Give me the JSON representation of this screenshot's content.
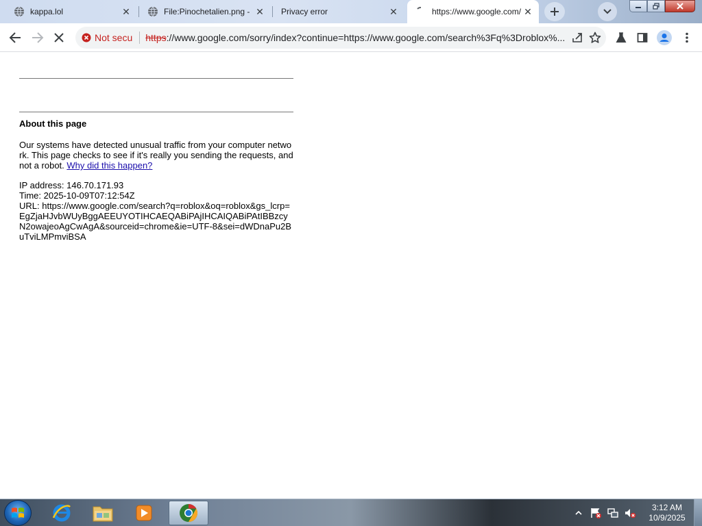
{
  "tabs": [
    {
      "title": "kappa.lol",
      "favicon": "globe-icon"
    },
    {
      "title": "File:Pinochetalien.png -",
      "favicon": "globe-icon"
    },
    {
      "title": "Privacy error",
      "favicon": "none"
    },
    {
      "title": "https://www.google.com/sorry",
      "favicon": "loading-spinner-icon",
      "active": true
    }
  ],
  "omnibox": {
    "security_label": "Not secu",
    "url_scheme": "https",
    "url_host": "://www.google.com",
    "url_path": "/sorry/index?continue=https://www.google.com/search%3Fq%3Droblox%..."
  },
  "page": {
    "about_title": "About this page",
    "para_text": "Our systems have detected unusual traffic from your computer network. This page checks to see if it's really you sending the requests, and not a robot. ",
    "why_link": "Why did this happen?",
    "ip_line": "IP address: 146.70.171.93",
    "time_line": "Time: 2025-10-09T07:12:54Z",
    "url_line": "URL: https://www.google.com/search?q=roblox&oq=roblox&gs_lcrp=EgZjaHJvbWUyBggAEEUYOTIHCAEQABiPAjIHCAIQABiPAtIBBzcyN2owajeoAgCwAgA&sourceid=chrome&ie=UTF-8&sei=dWDnaPu2BuTviLMPmviBSA"
  },
  "taskbar": {
    "apps": [
      "internet-explorer-icon",
      "file-explorer-icon",
      "media-player-icon",
      "chrome-icon"
    ],
    "time": "3:12 AM",
    "date": "10/9/2025"
  },
  "colors": {
    "not_secure_red": "#c5221f",
    "link_blue": "#1a0dab",
    "tab_strip": "#d9e3f3"
  }
}
